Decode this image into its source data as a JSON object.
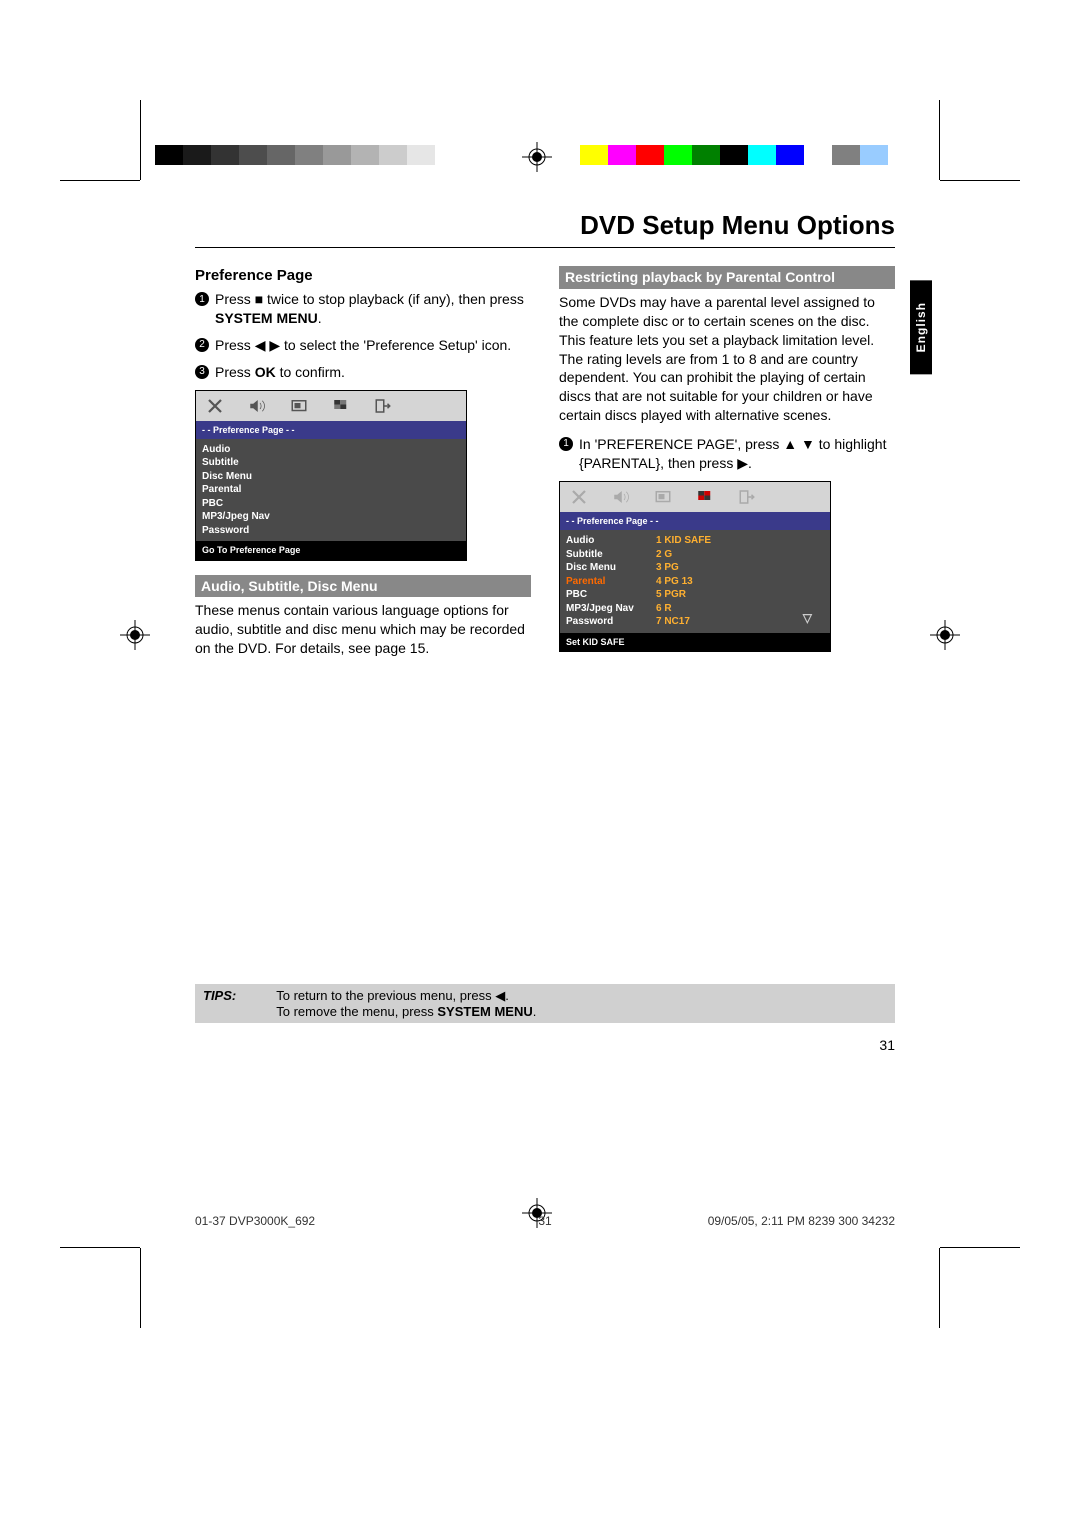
{
  "title": "DVD Setup Menu Options",
  "language_tab": "English",
  "left": {
    "heading": "Preference Page",
    "step1_a": "Press ",
    "step1_b": " twice to stop playback (if any), then press ",
    "step1_bold": "SYSTEM MENU",
    "step1_c": ".",
    "step2_a": "Press ",
    "step2_b": " to select the 'Preference Setup' icon.",
    "step3_a": "Press ",
    "step3_bold": "OK",
    "step3_b": " to confirm.",
    "osd": {
      "banner": "- -   Preference Page   - -",
      "items": [
        "Audio",
        "Subtitle",
        "Disc Menu",
        "Parental",
        "PBC",
        "MP3/Jpeg Nav",
        "Password"
      ],
      "footer": "Go To Preference Page"
    },
    "h_bar": "Audio, Subtitle, Disc Menu",
    "para": "These menus contain various language options for audio, subtitle and disc menu which may be recorded on the DVD.  For details, see page 15."
  },
  "right": {
    "h_bar": "Restricting playback by Parental Control",
    "para": "Some DVDs may have a parental level assigned to the complete disc or to certain scenes on the disc.  This feature lets you set a playback limitation level. The rating levels are from 1 to 8 and are country dependent.  You can prohibit the playing of certain discs that are not suitable for your children or have certain discs played with alternative scenes.",
    "step1_a": "In 'PREFERENCE PAGE', press ",
    "step1_b": " to highlight {PARENTAL}, then press ",
    "step1_c": ".",
    "osd": {
      "banner": "- -   Preference Page   - -",
      "rows": [
        {
          "l": "Audio",
          "r": "1 KID SAFE",
          "sel": false,
          "rsel": true
        },
        {
          "l": "Subtitle",
          "r": "2 G",
          "sel": false
        },
        {
          "l": "Disc Menu",
          "r": "3 PG",
          "sel": false
        },
        {
          "l": "Parental",
          "r": "4 PG 13",
          "sel": true
        },
        {
          "l": "PBC",
          "r": "5 PGR",
          "sel": false
        },
        {
          "l": "MP3/Jpeg Nav",
          "r": "6 R",
          "sel": false
        },
        {
          "l": "Password",
          "r": "7 NC17",
          "sel": false
        }
      ],
      "footer": "Set KID SAFE"
    }
  },
  "tips": {
    "label": "TIPS:",
    "line1_a": "To return to the previous menu, press ",
    "line1_b": ".",
    "line2_a": "To remove the menu, press ",
    "line2_bold": "SYSTEM MENU",
    "line2_b": "."
  },
  "page_number": "31",
  "footer": {
    "left": "01-37 DVP3000K_692",
    "mid": "31",
    "right_a": "09/05/05, 2:11 PM",
    "right_b": "8239 300 34232"
  },
  "colorbar_left": [
    "#000",
    "#1a1a1a",
    "#333",
    "#4d4d4d",
    "#666",
    "#808080",
    "#999",
    "#b3b3b3",
    "#ccc",
    "#e6e6e6",
    "#fff"
  ],
  "colorbar_right": [
    "#ffff00",
    "#ff00ff",
    "#ff0000",
    "#00ff00",
    "#008000",
    "#000",
    "#00ffff",
    "#0000ff",
    "#fff",
    "#808080",
    "#99ccff"
  ],
  "glyphs": {
    "stop": "■",
    "left": "◀",
    "right": "▶",
    "up": "▲",
    "down": "▼"
  }
}
